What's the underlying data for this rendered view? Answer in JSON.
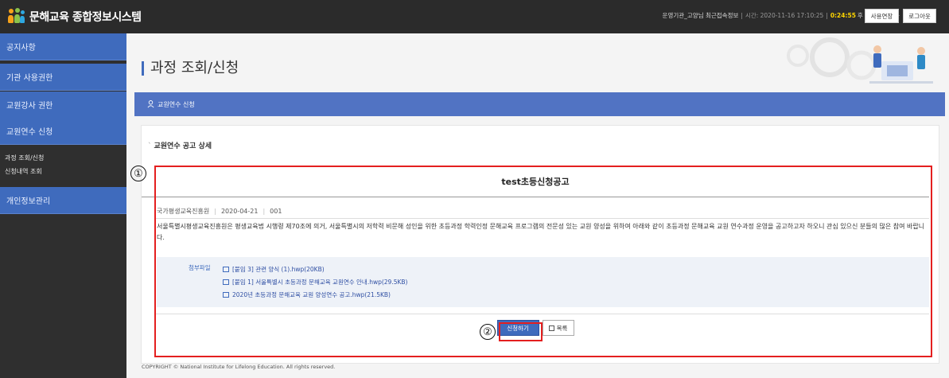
{
  "header": {
    "app_title": "문해교육 종합정보시스템",
    "user_info": "운영기관_고양님 최근접속정보",
    "time_label": "시간: 2020-11-16 17:10:25",
    "countdown": "0:24:55",
    "auto_logout": "후 자동 로그아웃",
    "change_button": "사용연장",
    "logout_button": "로그아웃"
  },
  "sidebar": {
    "items": [
      {
        "label": "공지사항"
      },
      {
        "label": "기관 사용권한"
      },
      {
        "label": "교원강사 권한"
      },
      {
        "label": "교원연수 신청"
      },
      {
        "label": "개인정보관리"
      }
    ],
    "sub_items": [
      {
        "label": "과정 조회/신청"
      },
      {
        "label": "신청내역 조회"
      }
    ]
  },
  "page": {
    "title": "과정 조회/신청",
    "breadcrumb": "교원연수 신청",
    "section_title": "교원연수 공고 상세"
  },
  "notice": {
    "title": "test초등신청공고",
    "org": "국가평생교육진흥원",
    "date": "2020-04-21",
    "number": "001",
    "body": "서울특별시평생교육진흥원은 평생교육법 시행령 제70조에 의거, 서울특별시의 저학력 비문해 성인을 위한 초등과정 학력인정 문해교육 프로그램의 전문성 있는 교원 양성을 위하여 아래와 같이 초등과정 문해교육 교원 연수과정 운영을 공고하고자 하오니 관심 있으신 분들의 많은 참여 바랍니다.",
    "attach_label": "첨부파일",
    "attachments": [
      {
        "name": "[붙임 3] 관련 양식 (1).hwp(20KB)"
      },
      {
        "name": "[붙임 1] 서울특별시 초등과정 문해교육 교원연수 안내.hwp(29.5KB)"
      },
      {
        "name": "2020년 초등과정 문해교육 교원 양성연수 공고.hwp(21.5KB)"
      }
    ],
    "apply_button": "신청하기",
    "list_button": "목록"
  },
  "footer": {
    "copyright": "COPYRIGHT © National Institute for Lifelong Education. All rights reserved."
  },
  "annotations": {
    "marker1": "①",
    "marker2": "②"
  },
  "colors": {
    "accent": "#3f6bbd",
    "highlight": "#e41f1f",
    "topbar": "#2b2b2b"
  }
}
